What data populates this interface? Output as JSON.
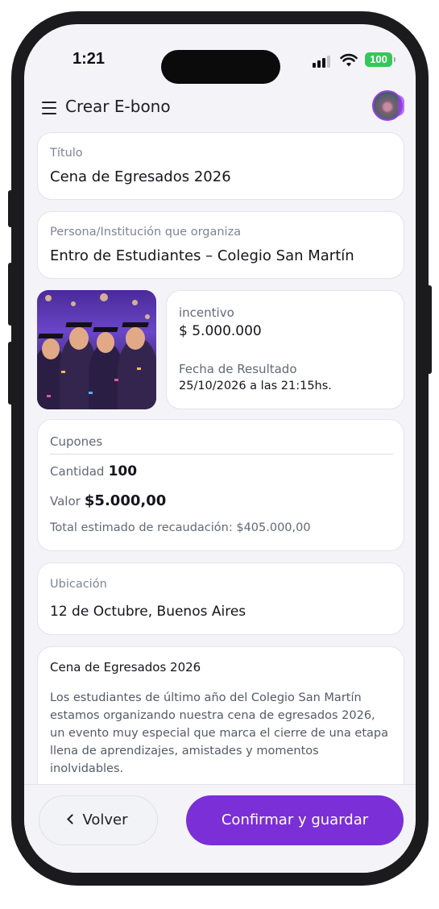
{
  "status_bar": {
    "time": "1:21",
    "battery": "100"
  },
  "header": {
    "title": "Crear E-bono"
  },
  "titulo": {
    "label": "Título",
    "value": "Cena de Egresados 2026"
  },
  "organizer": {
    "label": "Persona/Institución que organiza",
    "value": "Entro de Estudiantes – Colegio San Martín"
  },
  "incentive": {
    "label": "incentivo",
    "value": "$ 5.000.000",
    "date_label": "Fecha de Resultado",
    "date_value": "25/10/2026 a las 21:15hs."
  },
  "coupons": {
    "title": "Cupones",
    "quantity_label": "Cantidad",
    "quantity_value": "100",
    "price_label": "Valor",
    "price_value": "$5.000,00",
    "total_text": "Total estimado de recaudación: $405.000,00"
  },
  "location": {
    "label": "Ubicación",
    "value": "12 de Octubre,  Buenos Aires"
  },
  "description": {
    "title": "Cena de Egresados 2026",
    "text": "Los estudiantes de último año del Colegio San Martín estamos organizando nuestra cena de egresados 2026, un evento muy especial que marca el cierre de una etapa llena de aprendizajes, amistades y momentos inolvidables."
  },
  "actions": {
    "back_label": "Volver",
    "confirm_label": "Confirmar y guardar"
  },
  "colors": {
    "accent": "#7b2fd6",
    "battery": "#34c759",
    "background": "#f4f4f8"
  }
}
